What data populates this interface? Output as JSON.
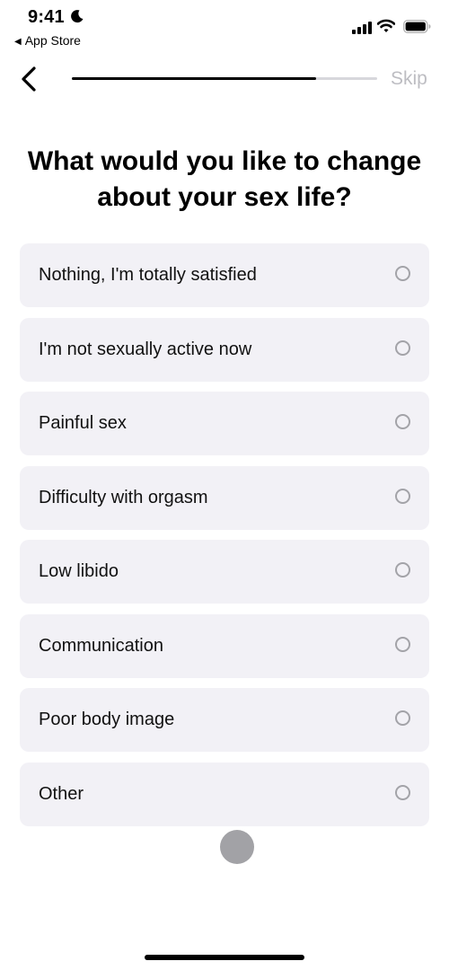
{
  "status_bar": {
    "time": "9:41",
    "focus_icon": "moon-icon",
    "back_app_label": "App Store",
    "back_app_icon": "◀",
    "signal_icon": "cellular-signal-icon",
    "wifi_icon": "wifi-icon",
    "battery_icon": "battery-icon"
  },
  "nav": {
    "back_icon": "chevron-left-icon",
    "progress": 0.8,
    "skip_label": "Skip"
  },
  "question": {
    "title": "What would you like to change about your sex life?"
  },
  "options": [
    {
      "label": "Nothing, I'm totally satisfied",
      "selected": false
    },
    {
      "label": "I'm not sexually active now",
      "selected": false
    },
    {
      "label": "Painful sex",
      "selected": false
    },
    {
      "label": "Difficulty with orgasm",
      "selected": false
    },
    {
      "label": "Low libido",
      "selected": false
    },
    {
      "label": "Communication",
      "selected": false
    },
    {
      "label": "Poor body image",
      "selected": false
    },
    {
      "label": "Other",
      "selected": false
    }
  ],
  "colors": {
    "option_background": "#f2f1f6",
    "radio_border": "#a3a3a8",
    "progress_fill": "#000000",
    "progress_track": "#d7d7dc",
    "skip_text": "#bdbdc2",
    "drag_dot": "#a2a2a6"
  }
}
